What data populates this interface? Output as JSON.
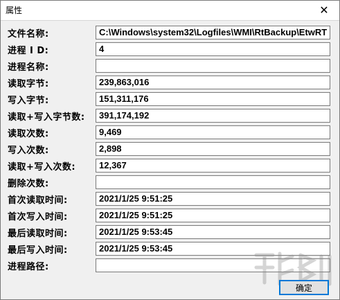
{
  "window": {
    "title": "属性",
    "close_glyph": "✕"
  },
  "rows": [
    {
      "label": "文件名称:",
      "value": "C:\\Windows\\system32\\Logfiles\\WMI\\RtBackup\\EtwRT"
    },
    {
      "label": "进程 I D:",
      "value": "4"
    },
    {
      "label": "进程名称:",
      "value": ""
    },
    {
      "label": "读取字节:",
      "value": "239,863,016"
    },
    {
      "label": "写入字节:",
      "value": "151,311,176"
    },
    {
      "label": "读取+写入字节数:",
      "value": "391,174,192"
    },
    {
      "label": "读取次数:",
      "value": "9,469"
    },
    {
      "label": "写入次数:",
      "value": "2,898"
    },
    {
      "label": "读取+写入次数:",
      "value": "12,367"
    },
    {
      "label": "删除次数:",
      "value": ""
    },
    {
      "label": "首次读取时间:",
      "value": "2021/1/25 9:51:25"
    },
    {
      "label": "首次写入时间:",
      "value": "2021/1/25 9:51:25"
    },
    {
      "label": "最后读取时间:",
      "value": "2021/1/25 9:53:45"
    },
    {
      "label": "最后写入时间:",
      "value": "2021/1/25 9:53:45"
    },
    {
      "label": "进程路径:",
      "value": ""
    }
  ],
  "buttons": {
    "ok_label": "确定"
  },
  "colors": {
    "accent": "#0078d7",
    "field_border": "#7a7a7a",
    "dialog_bg": "#f0f0f0"
  }
}
